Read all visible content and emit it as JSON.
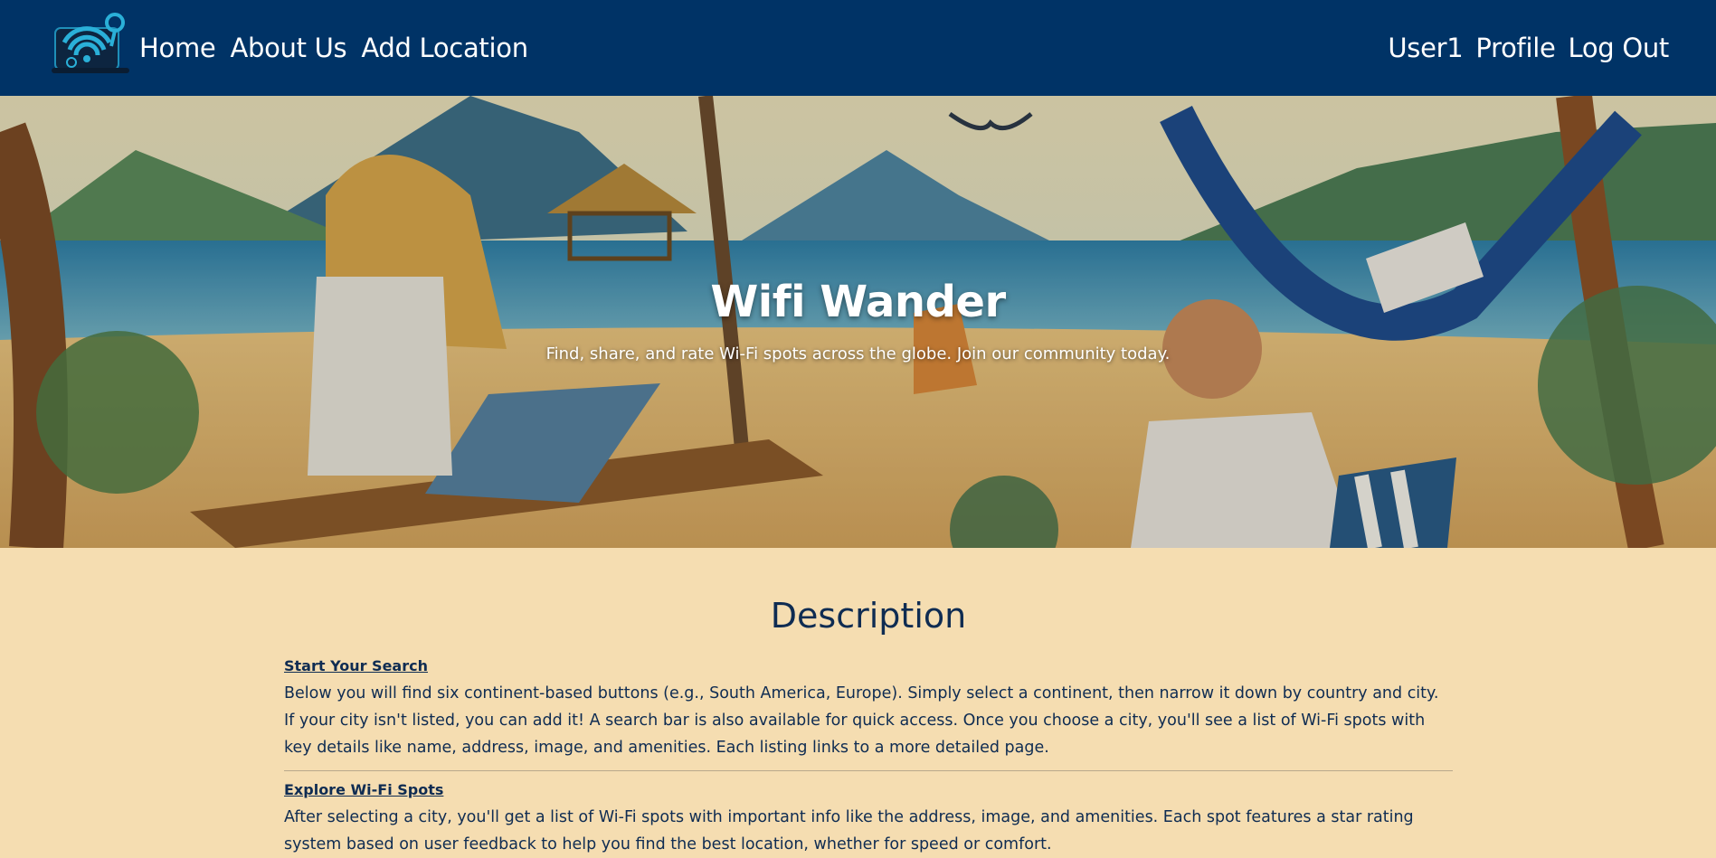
{
  "nav": {
    "logo_icon": "wifi-laptop-logo-icon",
    "left_links": [
      "Home",
      "About Us",
      "Add Location"
    ],
    "right_links": [
      "User1",
      "Profile",
      "Log Out"
    ]
  },
  "hero": {
    "title": "Wifi Wander",
    "subtitle": "Find, share, and rate Wi-Fi spots across the globe. Join our community today."
  },
  "description": {
    "title": "Description",
    "sections": [
      {
        "heading": "Start Your Search",
        "body": "Below you will find six continent-based buttons (e.g., South America, Europe). Simply select a continent, then narrow it down by country and city. If your city isn't listed, you can add it! A search bar is also available for quick access. Once you choose a city, you'll see a list of Wi-Fi spots with key details like name, address, image, and amenities. Each listing links to a more detailed page."
      },
      {
        "heading": "Explore Wi-Fi Spots",
        "body": "After selecting a city, you'll get a list of Wi-Fi spots with important info like the address, image, and amenities. Each spot features a star rating system based on user feedback to help you find the best location, whether for speed or comfort."
      }
    ]
  },
  "colors": {
    "navbar": "#003366",
    "page_background": "#f5ddb1",
    "text": "#0f2c52"
  }
}
